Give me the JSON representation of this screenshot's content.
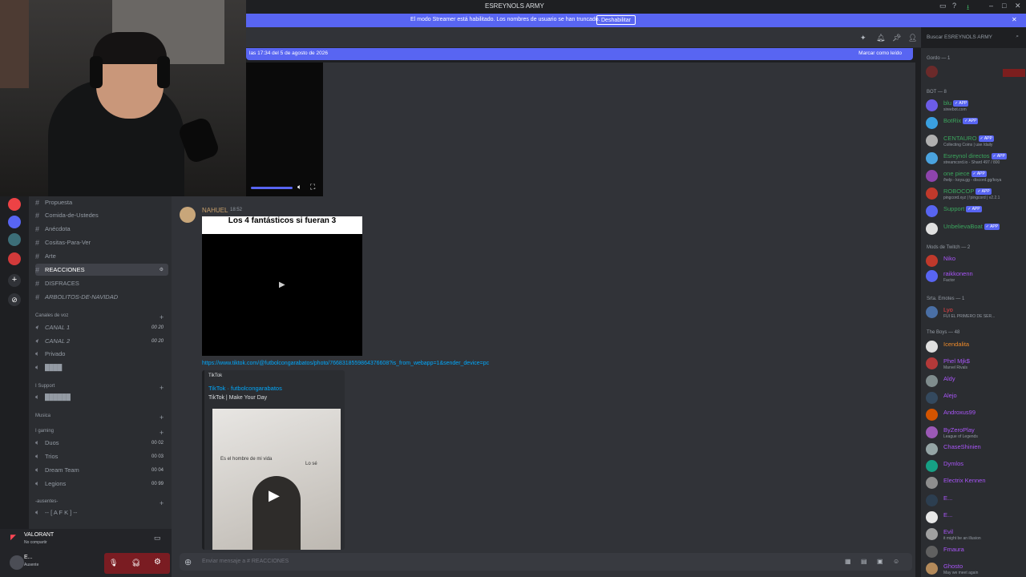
{
  "window": {
    "title": "ESREYNOLS ARMY"
  },
  "banner": {
    "message": "El modo Streamer está habilitado. Los nombres de usuario se han truncado.",
    "button": "Deshabilitar"
  },
  "new_messages": {
    "since": "las 17:34 del 5 de agosto de 2026",
    "mark_read": "Marcar como leído"
  },
  "search": {
    "placeholder": "Buscar ESREYNOLS ARMY"
  },
  "channels": [
    {
      "name": "Propuesta",
      "top": 0
    },
    {
      "name": "Comida-de-Ustedes"
    },
    {
      "name": "Anécdota"
    },
    {
      "name": "Cositas-Para-Ver"
    },
    {
      "name": "Arte"
    },
    {
      "name": "REACCIONES",
      "active": true
    },
    {
      "name": "DISFRACES"
    },
    {
      "name": "ARBOLITOS-DE-NAVIDAD"
    }
  ],
  "voice_category": "Canales de voz",
  "voice": [
    {
      "name": "CANAL 1",
      "count": "00 20"
    },
    {
      "name": "CANAL 2",
      "count": "00 20"
    },
    {
      "name": "Privado"
    },
    {
      "name": "████"
    }
  ],
  "support_category": "I Support",
  "support_item": "██████",
  "music_category": "Musica",
  "gaming_category": "I gaming",
  "gaming": [
    {
      "name": "Duos",
      "count": "00 02"
    },
    {
      "name": "Trios",
      "count": "00 03"
    },
    {
      "name": "Dream Team",
      "count": "00 04"
    },
    {
      "name": "Legions",
      "count": "00 99"
    }
  ],
  "away_category": "-ausentes-",
  "away_item": "-- [ A F K ] --",
  "activity": {
    "game": "VALORANT",
    "sub": "No compartir"
  },
  "user": {
    "name": "E...",
    "status": "Ausente"
  },
  "message": {
    "author": "NAHUEL",
    "time": "18:52",
    "video_title": "Los 4 fantásticos si fueran 3",
    "link": "https://www.tiktok.com/@futbolcongarabatos/photo/7668318559864376608?is_from_webapp=1&sender_device=pc",
    "embed_provider": "TikTok",
    "embed_title": "TikTok · futbolcongarabatos",
    "embed_desc": "TikTok | Make Your Day",
    "embed_caption_left": "Es el hombre de mi vida",
    "embed_caption_right": "Lo sé"
  },
  "composer": {
    "placeholder": "Enviar mensaje a # REACCIONES"
  },
  "members": {
    "gordo": "Gordo — 1",
    "bot": "BOT — 8",
    "mods": "Mods de Twitch — 2",
    "emotes": "Srta. Emotes — 1",
    "boys": "The Boys — 48",
    "bots": [
      {
        "name": "blu",
        "status": "sireebot.com",
        "color": "#3ba55d"
      },
      {
        "name": "BotRix",
        "status": "",
        "color": "#3ba55d"
      },
      {
        "name": "CENTAURO",
        "status": "Collecting Coins | use /daily",
        "color": "#3ba55d"
      },
      {
        "name": "Esreynol directos",
        "status": "streamcord.io - Shard 497 / 800",
        "color": "#3ba55d"
      },
      {
        "name": "one piece",
        "status": "/help - koya.gg - discord.gg/koya",
        "color": "#3ba55d"
      },
      {
        "name": "ROBOCOP",
        "status": "pingcord.xyz | !pingcord | v2.2.1",
        "color": "#3ba55d"
      },
      {
        "name": "Support",
        "status": "",
        "color": "#3ba55d"
      },
      {
        "name": "UnbelievaBoat",
        "status": "",
        "color": "#3ba55d"
      }
    ],
    "mods_list": [
      {
        "name": "Niko",
        "status": "",
        "color": "#a855f7"
      },
      {
        "name": "raikkonenn",
        "status": "Factor",
        "color": "#a855f7"
      }
    ],
    "boys_list": [
      {
        "name": "Icendalita",
        "status": "",
        "color": "#ed8a2a"
      },
      {
        "name": "Phel Mjk$",
        "status": "Marvel Rivals",
        "color": "#a855f7"
      },
      {
        "name": "Aldy",
        "status": "",
        "color": "#a855f7"
      },
      {
        "name": "Alejo",
        "status": "",
        "color": "#a855f7"
      },
      {
        "name": "Androxus99",
        "status": "",
        "color": "#a855f7"
      },
      {
        "name": "ByZeroPlay",
        "status": "League of Legends",
        "color": "#a855f7"
      },
      {
        "name": "ChaseShinien",
        "status": "",
        "color": "#a855f7"
      },
      {
        "name": "Dymlos",
        "status": "",
        "color": "#a855f7"
      },
      {
        "name": "Electrix Kennen",
        "status": "",
        "color": "#a855f7"
      },
      {
        "name": "E...",
        "status": "",
        "color": "#a855f7"
      },
      {
        "name": "E...",
        "status": "",
        "color": "#a855f7"
      },
      {
        "name": "Evil",
        "status": "it might be an illusion",
        "color": "#a855f7"
      },
      {
        "name": "Fmaura",
        "status": "",
        "color": "#a855f7"
      },
      {
        "name": "Ghosto",
        "status": "May we meet again",
        "color": "#a855f7"
      }
    ]
  }
}
